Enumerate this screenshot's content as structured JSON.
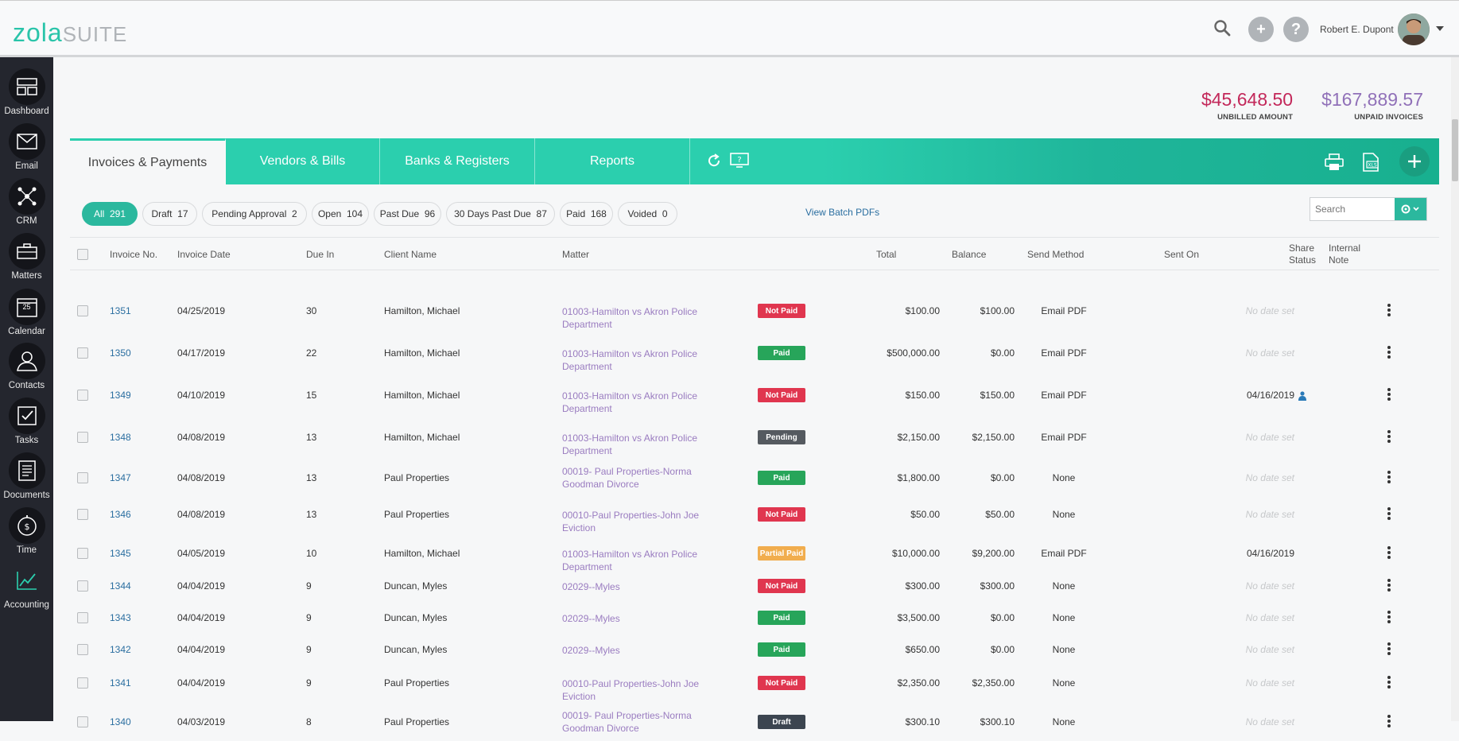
{
  "header": {
    "logo_primary": "zola",
    "logo_secondary": "SUITE",
    "user_name": "Robert E. Dupont",
    "add_label": "+",
    "help_label": "?"
  },
  "sidebar": {
    "items": [
      {
        "label": "Dashboard",
        "icon": "dashboard-icon"
      },
      {
        "label": "Email",
        "icon": "email-icon"
      },
      {
        "label": "CRM",
        "icon": "crm-icon"
      },
      {
        "label": "Matters",
        "icon": "briefcase-icon"
      },
      {
        "label": "Calendar",
        "icon": "calendar-icon"
      },
      {
        "label": "Contacts",
        "icon": "contacts-icon"
      },
      {
        "label": "Tasks",
        "icon": "tasks-icon"
      },
      {
        "label": "Documents",
        "icon": "documents-icon"
      },
      {
        "label": "Time",
        "icon": "time-icon"
      },
      {
        "label": "Accounting",
        "icon": "accounting-icon"
      }
    ],
    "calendar_day": "25"
  },
  "summary": {
    "unbilled_value": "$45,648.50",
    "unbilled_label": "UNBILLED AMOUNT",
    "unpaid_value": "$167,889.57",
    "unpaid_label": "UNPAID INVOICES"
  },
  "tabs": [
    {
      "label": "Invoices & Payments",
      "active": true
    },
    {
      "label": "Vendors & Bills",
      "active": false
    },
    {
      "label": "Banks & Registers",
      "active": false
    },
    {
      "label": "Reports",
      "active": false
    }
  ],
  "filters": [
    {
      "label": "All",
      "count": "291",
      "active": true
    },
    {
      "label": "Draft",
      "count": "17"
    },
    {
      "label": "Pending Approval",
      "count": "2"
    },
    {
      "label": "Open",
      "count": "104"
    },
    {
      "label": "Past Due",
      "count": "96"
    },
    {
      "label": "30 Days Past Due",
      "count": "87"
    },
    {
      "label": "Paid",
      "count": "168"
    },
    {
      "label": "Voided",
      "count": "0"
    }
  ],
  "batch_link": "View Batch PDFs",
  "search": {
    "placeholder": "Search",
    "value": ""
  },
  "table": {
    "columns": {
      "invoice_no": "Invoice No.",
      "invoice_date": "Invoice Date",
      "due_in": "Due In",
      "client": "Client Name",
      "matter": "Matter",
      "total": "Total",
      "balance": "Balance",
      "send_method": "Send Method",
      "sent_on": "Sent On",
      "share_status_1": "Share",
      "share_status_2": "Status",
      "internal_note_1": "Internal",
      "internal_note_2": "Note"
    },
    "rows": [
      {
        "no": "1351",
        "date": "04/25/2019",
        "due": "30",
        "client": "Hamilton, Michael",
        "matter": "01003-Hamilton vs Akron Police Department",
        "status": "Not Paid",
        "total": "$100.00",
        "balance": "$100.00",
        "send": "Email PDF",
        "sent_on": "No date set",
        "shared": false
      },
      {
        "no": "1350",
        "date": "04/17/2019",
        "due": "22",
        "client": "Hamilton, Michael",
        "matter": "01003-Hamilton vs Akron Police Department",
        "status": "Paid",
        "total": "$500,000.00",
        "balance": "$0.00",
        "send": "Email PDF",
        "sent_on": "No date set",
        "shared": false
      },
      {
        "no": "1349",
        "date": "04/10/2019",
        "due": "15",
        "client": "Hamilton, Michael",
        "matter": "01003-Hamilton vs Akron Police Department",
        "status": "Not Paid",
        "total": "$150.00",
        "balance": "$150.00",
        "send": "Email PDF",
        "sent_on": "04/16/2019",
        "shared": true
      },
      {
        "no": "1348",
        "date": "04/08/2019",
        "due": "13",
        "client": "Hamilton, Michael",
        "matter": "01003-Hamilton vs Akron Police Department",
        "status": "Pending",
        "total": "$2,150.00",
        "balance": "$2,150.00",
        "send": "Email PDF",
        "sent_on": "No date set",
        "shared": false
      },
      {
        "no": "1347",
        "date": "04/08/2019",
        "due": "13",
        "client": "Paul Properties",
        "matter": "00019- Paul Properties-Norma Goodman Divorce",
        "status": "Paid",
        "total": "$1,800.00",
        "balance": "$0.00",
        "send": "None",
        "sent_on": "No date set",
        "shared": false
      },
      {
        "no": "1346",
        "date": "04/08/2019",
        "due": "13",
        "client": "Paul Properties",
        "matter": "00010-Paul Properties-John Joe Eviction",
        "status": "Not Paid",
        "total": "$50.00",
        "balance": "$50.00",
        "send": "None",
        "sent_on": "No date set",
        "shared": false
      },
      {
        "no": "1345",
        "date": "04/05/2019",
        "due": "10",
        "client": "Hamilton, Michael",
        "matter": "01003-Hamilton vs Akron Police Department",
        "status": "Partial Paid",
        "total": "$10,000.00",
        "balance": "$9,200.00",
        "send": "Email PDF",
        "sent_on": "04/16/2019",
        "shared": false
      },
      {
        "no": "1344",
        "date": "04/04/2019",
        "due": "9",
        "client": "Duncan, Myles",
        "matter": "02029--Myles",
        "status": "Not Paid",
        "total": "$300.00",
        "balance": "$300.00",
        "send": "None",
        "sent_on": "No date set",
        "shared": false
      },
      {
        "no": "1343",
        "date": "04/04/2019",
        "due": "9",
        "client": "Duncan, Myles",
        "matter": "02029--Myles",
        "status": "Paid",
        "total": "$3,500.00",
        "balance": "$0.00",
        "send": "None",
        "sent_on": "No date set",
        "shared": false
      },
      {
        "no": "1342",
        "date": "04/04/2019",
        "due": "9",
        "client": "Duncan, Myles",
        "matter": "02029--Myles",
        "status": "Paid",
        "total": "$650.00",
        "balance": "$0.00",
        "send": "None",
        "sent_on": "No date set",
        "shared": false
      },
      {
        "no": "1341",
        "date": "04/04/2019",
        "due": "9",
        "client": "Paul Properties",
        "matter": "00010-Paul Properties-John Joe Eviction",
        "status": "Not Paid",
        "total": "$2,350.00",
        "balance": "$2,350.00",
        "send": "None",
        "sent_on": "No date set",
        "shared": false
      },
      {
        "no": "1340",
        "date": "04/03/2019",
        "due": "8",
        "client": "Paul Properties",
        "matter": "00019- Paul Properties-Norma Goodman Divorce",
        "status": "Draft",
        "total": "$300.10",
        "balance": "$300.10",
        "send": "None",
        "sent_on": "No date set",
        "shared": false
      }
    ]
  },
  "status_colors": {
    "Not Paid": "#e0364f",
    "Paid": "#27a55a",
    "Pending": "#555a60",
    "Partial Paid": "#f1ad4e",
    "Draft": "#3c4550"
  },
  "accent_color": "#2bcfae"
}
